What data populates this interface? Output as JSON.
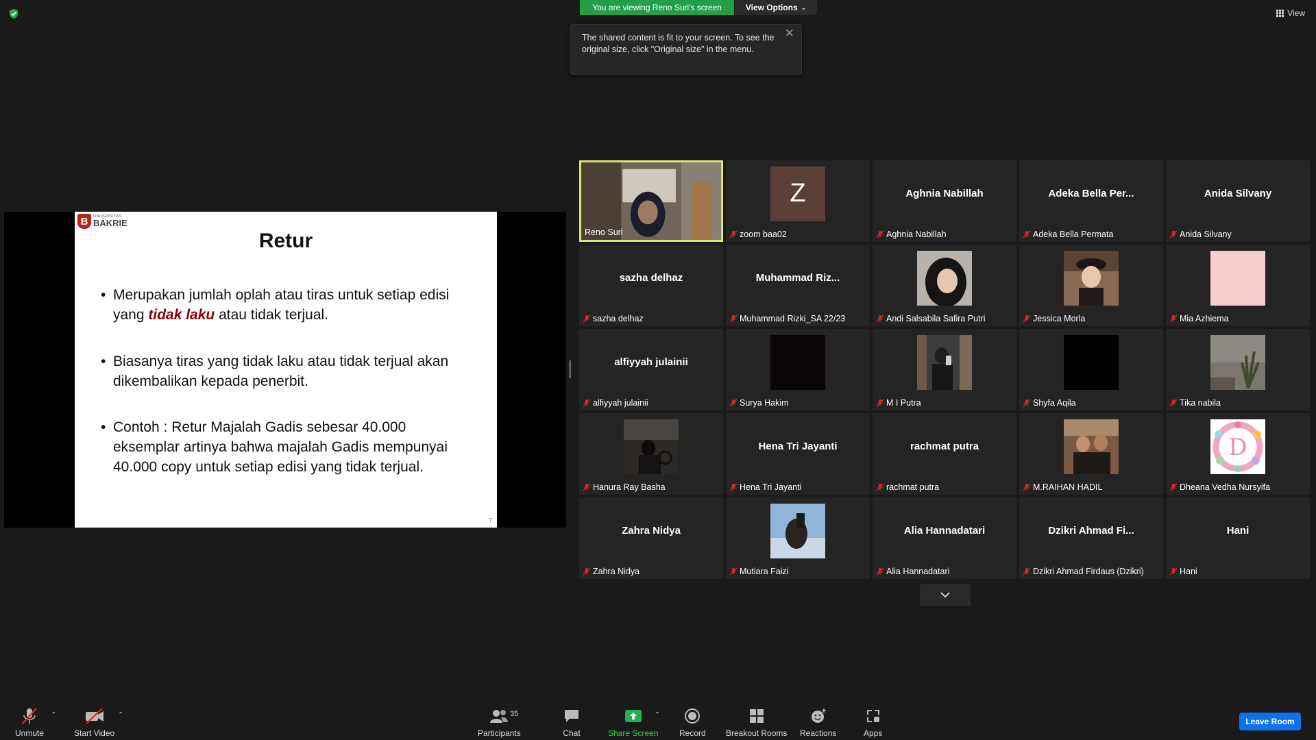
{
  "colors": {
    "banner_green": "#23a047",
    "active_speaker": "#d9e86f",
    "muted_red": "#e02828",
    "leave_blue": "#0e72ed",
    "slide_emphasis": "#8b0000"
  },
  "top": {
    "viewing_banner": "You are viewing Reno Suri's screen",
    "view_options": "View Options",
    "tooltip": "The shared content is fit to your screen. To see the original size, click \"Original size\" in the menu.",
    "view_label": "View"
  },
  "slide": {
    "logo_small": "UNIVERSITAS",
    "logo_big": "BAKRIE",
    "logo_letter": "B",
    "title": "Retur",
    "bullet1_pre": "Merupakan jumlah oplah atau tiras untuk setiap edisi yang ",
    "bullet1_emph": "tidak laku",
    "bullet1_post": " atau tidak terjual.",
    "bullet2": "Biasanya tiras yang tidak laku atau tidak terjual akan dikembalikan kepada penerbit.",
    "bullet3": "Contoh : Retur Majalah Gadis sebesar 40.000 eksemplar artinya bahwa majalah Gadis mempunyai 40.000 copy untuk setiap edisi yang tidak terjual.",
    "page_number": "7"
  },
  "participants": [
    {
      "label": "Reno Suri"
    },
    {
      "label": "zoom baa02",
      "letter": "Z"
    },
    {
      "label": "Aghnia Nabillah",
      "display": "Aghnia Nabillah"
    },
    {
      "label": "Adeka Bella Permata",
      "display": "Adeka Bella Per..."
    },
    {
      "label": "Anida Silvany",
      "display": "Anida Silvany"
    },
    {
      "label": "sazha delhaz",
      "display": "sazha delhaz"
    },
    {
      "label": "Muhammad Rizki_SA 22/23",
      "display": "Muhammad Riz..."
    },
    {
      "label": "Andi Salsabila Safira Putri"
    },
    {
      "label": "Jessica Morla"
    },
    {
      "label": "Mia Azhiema"
    },
    {
      "label": "alfiyyah julainii",
      "display": "alfiyyah julainii"
    },
    {
      "label": "Surya Hakim"
    },
    {
      "label": "M I Putra"
    },
    {
      "label": "Shyfa Aqila"
    },
    {
      "label": "Tika nabila"
    },
    {
      "label": "Hanura Ray Basha"
    },
    {
      "label": "Hena Tri Jayanti",
      "display": "Hena Tri Jayanti"
    },
    {
      "label": "rachmat putra",
      "display": "rachmat putra"
    },
    {
      "label": "M.RAIHAN HADIL"
    },
    {
      "label": "Dheana Vedha Nursyifa"
    },
    {
      "label": "Zahra Nidya",
      "display": "Zahra Nidya"
    },
    {
      "label": "Mutiara Faizi"
    },
    {
      "label": "Alia Hannadatari",
      "display": "Alia Hannadatari"
    },
    {
      "label": "Dzikri Ahmad Firdaus (Dzikri)",
      "display": "Dzikri Ahmad Fi..."
    },
    {
      "label": "Hani",
      "display": "Hani"
    }
  ],
  "toolbar": {
    "unmute": "Unmute",
    "start_video": "Start Video",
    "participants": "Participants",
    "participants_count": "35",
    "chat": "Chat",
    "share_screen": "Share Screen",
    "record": "Record",
    "breakout_rooms": "Breakout Rooms",
    "reactions": "Reactions",
    "apps": "Apps",
    "leave": "Leave Room"
  }
}
